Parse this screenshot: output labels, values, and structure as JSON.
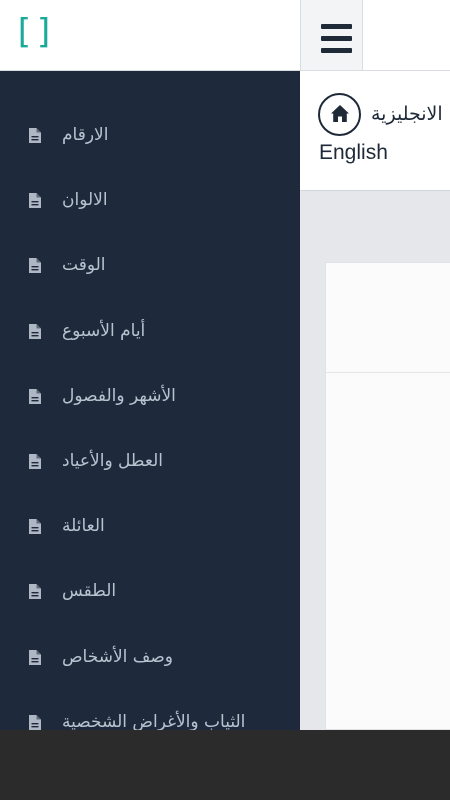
{
  "app": {
    "logo_text": "[]",
    "brand_color": "#1ba99a",
    "drawer_bg": "#1e2a3b"
  },
  "drawer": {
    "items": [
      {
        "label": "الارقام",
        "icon": "document-icon"
      },
      {
        "label": "الالوان",
        "icon": "document-icon"
      },
      {
        "label": "الوقت",
        "icon": "document-icon"
      },
      {
        "label": "أيام الأسبوع",
        "icon": "document-icon"
      },
      {
        "label": "الأشهر والفصول",
        "icon": "document-icon"
      },
      {
        "label": "العطل والأعياد",
        "icon": "document-icon"
      },
      {
        "label": "العائلة",
        "icon": "document-icon"
      },
      {
        "label": "الطقس",
        "icon": "document-icon"
      },
      {
        "label": "وصف الأشخاص",
        "icon": "document-icon"
      },
      {
        "label": "الثياب والأغراض الشخصية",
        "icon": "document-icon"
      }
    ]
  },
  "header": {
    "menu_icon": "hamburger-icon",
    "home_icon": "home-icon",
    "title_arabic": "الانجليزية",
    "title_english": "English"
  }
}
